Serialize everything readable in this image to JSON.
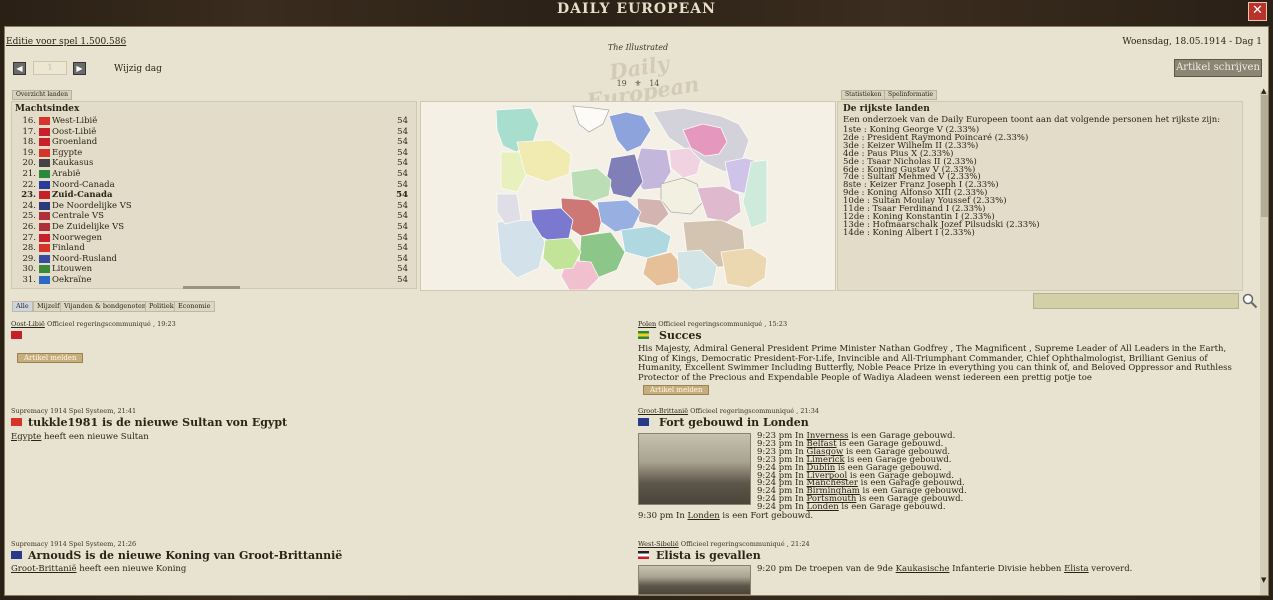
{
  "window": {
    "title": "DAILY EUROPEAN",
    "close_label": "✕"
  },
  "header": {
    "edition": "Editie voor spel 1.500.586",
    "date": "Woensdag, 18.05.1914 - Dag 1",
    "day_value": "1",
    "change_day": "Wijzig dag",
    "masthead_small": "The Illustrated",
    "masthead_big": "Daily European",
    "masthead_year_left": "19",
    "masthead_year_right": "14",
    "write_article": "Artikel schrijven"
  },
  "left_panel": {
    "tab": "Overzicht landen",
    "title": "Machtsindex",
    "rows": [
      {
        "rank": "16.",
        "name": "West-Libië",
        "value": "54",
        "flag_color": "#d6342a",
        "bold": false
      },
      {
        "rank": "17.",
        "name": "Oost-Libië",
        "value": "54",
        "flag_color": "#c8202a",
        "bold": false
      },
      {
        "rank": "18.",
        "name": "Groenland",
        "value": "54",
        "flag_color": "#c8202a",
        "bold": false
      },
      {
        "rank": "19.",
        "name": "Egypte",
        "value": "54",
        "flag_color": "#d6342a",
        "bold": false
      },
      {
        "rank": "20.",
        "name": "Kaukasus",
        "value": "54",
        "flag_color": "#444444",
        "bold": false
      },
      {
        "rank": "21.",
        "name": "Arabië",
        "value": "54",
        "flag_color": "#2a8a3a",
        "bold": false
      },
      {
        "rank": "22.",
        "name": "Noord-Canada",
        "value": "54",
        "flag_color": "#2a3a9a",
        "bold": false
      },
      {
        "rank": "23.",
        "name": "Zuid-Canada",
        "value": "54",
        "flag_color": "#c8202a",
        "bold": true
      },
      {
        "rank": "24.",
        "name": "De Noordelijke VS",
        "value": "54",
        "flag_color": "#2a3a7a",
        "bold": false
      },
      {
        "rank": "25.",
        "name": "Centrale VS",
        "value": "54",
        "flag_color": "#b0303a",
        "bold": false
      },
      {
        "rank": "26.",
        "name": "De Zuidelijke VS",
        "value": "54",
        "flag_color": "#b0303a",
        "bold": false
      },
      {
        "rank": "27.",
        "name": "Noorwegen",
        "value": "54",
        "flag_color": "#c8202a",
        "bold": false
      },
      {
        "rank": "28.",
        "name": "Finland",
        "value": "54",
        "flag_color": "#d6342a",
        "bold": false
      },
      {
        "rank": "29.",
        "name": "Noord-Rusland",
        "value": "54",
        "flag_color": "#3a4aa0",
        "bold": false
      },
      {
        "rank": "30.",
        "name": "Litouwen",
        "value": "54",
        "flag_color": "#3a8a3a",
        "bold": false
      },
      {
        "rank": "31.",
        "name": "Oekraïne",
        "value": "54",
        "flag_color": "#2a6ac0",
        "bold": false
      }
    ]
  },
  "right_panel": {
    "tabs": [
      "Statistieken",
      "Spelinformatie"
    ],
    "title": "De rijkste landen",
    "intro": "Een onderzoek van de Daily Europeen toont aan dat volgende personen het rijkste zijn:",
    "rows": [
      "1ste : Koning George V (2.33%)",
      "2de : President Raymond Poincaré (2.33%)",
      "3de : Keizer Wilhelm II (2.33%)",
      "4de : Paus Pius X (2.33%)",
      "5de : Tsaar Nicholas II (2.33%)",
      "6de : Koning Gustav V (2.33%)",
      "7de : Sultan Mehmed V (2.33%)",
      "8ste : Keizer Franz Joseph I (2.33%)",
      "9de : Koning Alfonso XIII (2.33%)",
      "10de : Sultan Moulay Youssef (2.33%)",
      "11de : Tsaar Ferdinand I (2.33%)",
      "12de : Koning Konstantin I (2.33%)",
      "13de : Hofmaarschalk Jozef Pilsudski (2.33%)",
      "14de : Koning Albert I (2.33%)"
    ]
  },
  "filters": [
    "Alle",
    "Mijzelf",
    "Vijanden & bondgenoten",
    "Politiek",
    "Economie"
  ],
  "articles": {
    "a1": {
      "country": "Oost-Libië",
      "meta": " Officieel regeringscommuniqué , 19:23",
      "button": "Artikel melden"
    },
    "a2": {
      "country": "Polen",
      "meta": " Officieel regeringscommuniqué , 15:23",
      "headline": "Succes",
      "body": "His Majesty, Admiral General President Prime Minister Nathan Godfrey , The Magnificent , Supreme Leader of All Leaders in the Earth, King of Kings, Democratic President-For-Life, Invincible and All-Triumphant Commander, Chief Ophthalmologist, Brilliant Genius of Humanity, Excellent Swimmer Including Butterfly, Noble Peace Prize in everything you can think of, and Beloved Oppressor and Ruthless Protector of the Precious and Expendable People of Wadiya Aladeen wenst iedereen een prettig potje toe",
      "button": "Artikel melden"
    },
    "a3": {
      "meta": "Supremacy 1914 Spel Systeem, 21:41",
      "headline": "tukkle1981 is de nieuwe Sultan von Egypt",
      "link": "Egypte",
      "text": " heeft een nieuwe Sultan"
    },
    "a4": {
      "country": "Groot-Brittanië",
      "meta": " Officieel regeringscommuniqué , 21:34",
      "headline": "Fort gebouwd in Londen",
      "lines": [
        {
          "pre": "9:23 pm In ",
          "city": "Inverness",
          "post": " is een Garage gebouwd."
        },
        {
          "pre": "9:23 pm In ",
          "city": "Belfast",
          "post": " is een Garage gebouwd."
        },
        {
          "pre": "9:23 pm In ",
          "city": "Glasgow",
          "post": " is een Garage gebouwd."
        },
        {
          "pre": "9:23 pm In ",
          "city": "Limerick",
          "post": " is een Garage gebouwd."
        },
        {
          "pre": "9:24 pm In ",
          "city": "Dublin",
          "post": " is een Garage gebouwd."
        },
        {
          "pre": "9:24 pm In ",
          "city": "Liverpool",
          "post": " is een Garage gebouwd."
        },
        {
          "pre": "9:24 pm In ",
          "city": "Manchester",
          "post": " is een Garage gebouwd."
        },
        {
          "pre": "9:24 pm In ",
          "city": "Birmingham",
          "post": " is een Garage gebouwd."
        },
        {
          "pre": "9:24 pm In ",
          "city": "Portsmouth",
          "post": " is een Garage gebouwd."
        },
        {
          "pre": "9:24 pm In ",
          "city": "Londen",
          "post": " is een Garage gebouwd."
        }
      ],
      "final_pre": "9:30 pm In ",
      "final_city": "Londen",
      "final_post": " is een Fort gebouwd."
    },
    "a5": {
      "meta": "Supremacy 1914 Spel Systeem, 21:26",
      "headline": "ArnoudS is de nieuwe Koning van Groot-Brittannië",
      "link": "Groot-Brittanië",
      "text": " heeft een nieuwe Koning"
    },
    "a6": {
      "country": "West-Sibelië",
      "meta": " Officieel regeringscommuniqué , 21:24",
      "headline": "Elista is gevallen",
      "pre": "9:20 pm De troepen van de 9de ",
      "link1": "Kaukasische",
      "mid": " Infanterie Divisie hebben ",
      "link2": "Elista",
      "post": " veroverd."
    }
  }
}
